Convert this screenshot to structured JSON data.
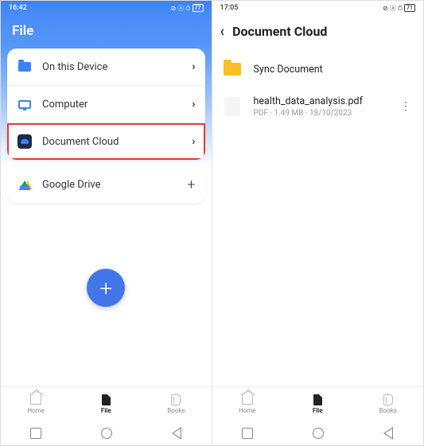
{
  "left": {
    "status": {
      "time": "16:42",
      "battery": "77"
    },
    "title": "File",
    "menu": [
      {
        "label": "On this Device",
        "icon": "folder-blue",
        "action": "chevron"
      },
      {
        "label": "Computer",
        "icon": "computer",
        "action": "chevron"
      },
      {
        "label": "Document Cloud",
        "icon": "cloud",
        "action": "chevron",
        "highlighted": true
      },
      {
        "label": "Google Drive",
        "icon": "gdrive",
        "action": "plus"
      }
    ],
    "fab_label": "+",
    "tabs": {
      "home": "Home",
      "file": "File",
      "books": "Books"
    }
  },
  "right": {
    "status": {
      "time": "17:05",
      "battery": "71"
    },
    "title": "Document Cloud",
    "items": [
      {
        "type": "folder",
        "name": "Sync Document"
      },
      {
        "type": "file",
        "name": "health_data_analysis.pdf",
        "meta": "PDF · 1.49 MB · 18/10/2023"
      }
    ],
    "tabs": {
      "home": "Home",
      "file": "File",
      "books": "Books"
    }
  }
}
